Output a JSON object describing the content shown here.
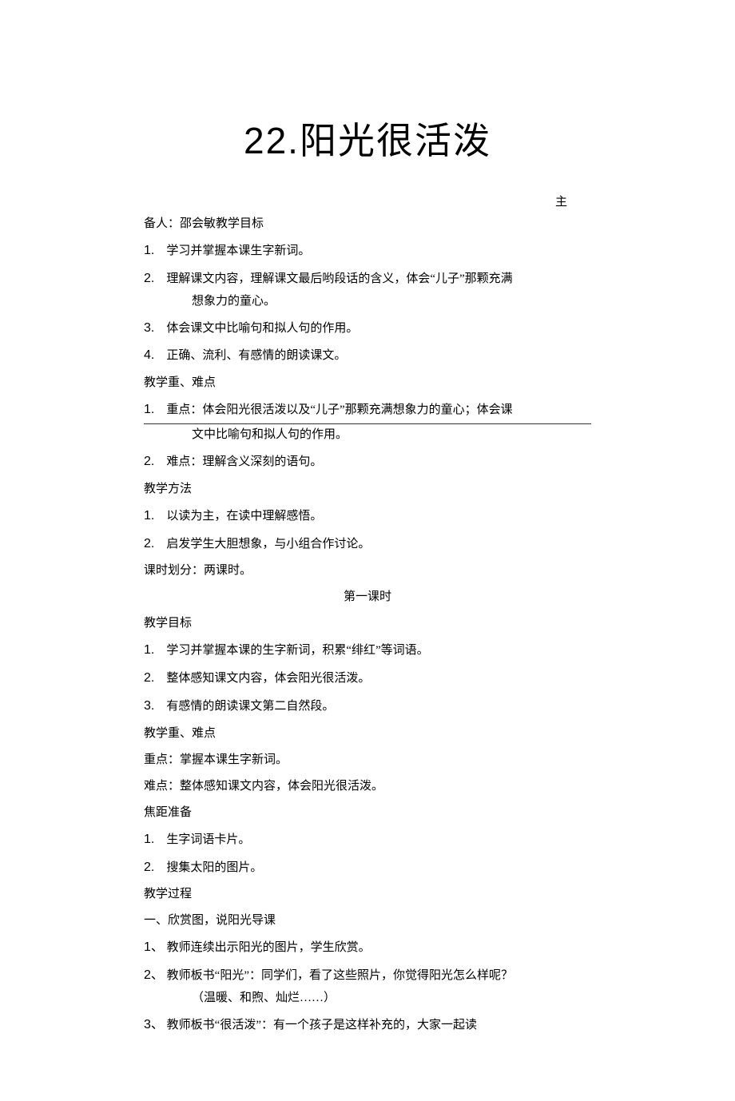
{
  "title_num": "22.",
  "title_text": "阳光很活泼",
  "author_prefix": "主",
  "author_line": "备人：邵会敏教学目标",
  "goals": {
    "g1_num": "1.",
    "g1": "学习并掌握本课生字新词。",
    "g2_num": "2.",
    "g2": "理解课文内容，理解课文最后哟段话的含义，体会“儿子”那颗充满",
    "g2_cont": "想象力的童心。",
    "g3_num": "3.",
    "g3": "体会课文中比喻句和拟人句的作用。",
    "g4_num": "4.",
    "g4": "正确、流利、有感情的朗读课文。"
  },
  "section_difficulty": "教学重、难点",
  "diff1_num": "1.",
  "diff1": "重点：体会阳光很活泼以及“儿子”那颗充满想象力的童心；体会课",
  "diff1_cont": "文中比喻句和拟人句的作用。",
  "diff2_num": "2.",
  "diff2": "难点：理解含义深刻的语句。",
  "section_method": "教学方法",
  "method1_num": "1.",
  "method1": "以读为主，在读中理解感悟。",
  "method2_num": "2.",
  "method2": "启发学生大胆想象，与小组合作讨论。",
  "class_split": "课时划分：两课时。",
  "lesson1_title": "第一课时",
  "section_goal2": "教学目标",
  "l1g1_num": "1.",
  "l1g1": "学习并掌握本课的生字新词，积累“绯红”等词语。",
  "l1g2_num": "2.",
  "l1g2": "整体感知课文内容，体会阳光很活泼。",
  "l1g3_num": "3.",
  "l1g3": "有感情的朗读课文第二自然段。",
  "section_diff2": "教学重、难点",
  "diff2_key": "重点：掌握本课生字新词。",
  "diff2_hard": "难点：整体感知课文内容，体会阳光很活泼。",
  "section_prep": "焦距准备",
  "prep1_num": "1.",
  "prep1": "生字词语卡片。",
  "prep2_num": "2.",
  "prep2": "搜集太阳的图片。",
  "section_process": "教学过程",
  "proc_h1": "一、欣赏图，说阳光导课",
  "proc1_num": "1、",
  "proc1": "教师连续出示阳光的图片，学生欣赏。",
  "proc2_num": "2、",
  "proc2": "教师板书“阳光”：同学们，看了这些照片，你觉得阳光怎么样呢？",
  "proc2_cont": "（温暖、和煦、灿烂……）",
  "proc3_num": "3、",
  "proc3": "教师板书“很活泼”：有一个孩子是这样补充的，大家一起读"
}
